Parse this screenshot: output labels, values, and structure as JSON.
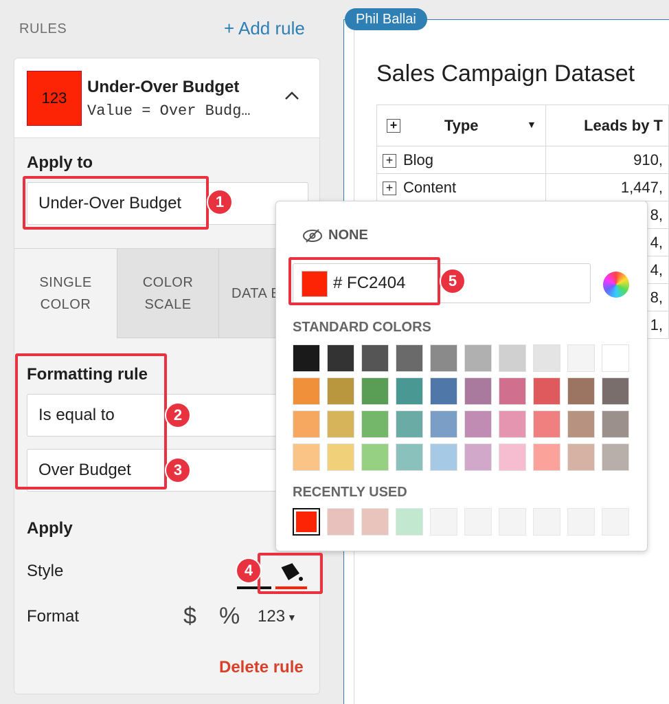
{
  "left_panel": {
    "header": {
      "rules_label": "RULES",
      "add_rule_label": "+ Add rule"
    },
    "rule_card": {
      "preview_text": "123",
      "preview_color": "#FC2404",
      "title": "Under-Over Budget",
      "subtitle": "Value = Over Budg…"
    },
    "apply_to": {
      "heading": "Apply to",
      "value": "Under-Over Budget"
    },
    "tabs": [
      {
        "line1": "SINGLE",
        "line2": "COLOR"
      },
      {
        "line1": "COLOR",
        "line2": "SCALE"
      },
      {
        "line1": "DATA B",
        "line2": ""
      }
    ],
    "formatting_rule": {
      "heading": "Formatting rule",
      "condition": "Is equal to",
      "value": "Over Budget"
    },
    "apply": {
      "heading": "Apply",
      "style_label": "Style",
      "format_label": "Format",
      "format_currency": "$",
      "format_percent": "%",
      "format_number": "123"
    },
    "delete_label": "Delete rule"
  },
  "right_panel": {
    "user_tag": "Phil Ballai",
    "dataset_title": "Sales Campaign Dataset",
    "table": {
      "headers": [
        "Type",
        "Leads by T"
      ],
      "rows": [
        {
          "type": "Blog",
          "leads": "910,"
        },
        {
          "type": "Content",
          "leads": "1,447,"
        },
        {
          "type": "",
          "leads": "8,"
        },
        {
          "type": "",
          "leads": "4,"
        },
        {
          "type": "",
          "leads": "4,"
        },
        {
          "type": "",
          "leads": "8,"
        },
        {
          "type": "",
          "leads": "1,"
        }
      ]
    }
  },
  "color_picker": {
    "none_label": "NONE",
    "hex_prefix": "#",
    "hex_value": "FC2404",
    "current_color": "#FC2404",
    "standard_label": "STANDARD COLORS",
    "standard_colors": [
      [
        "#1a1a1a",
        "#333333",
        "#555555",
        "#6a6a6a",
        "#8a8a8a",
        "#b0b0b0",
        "#d0d0d0",
        "#e4e4e4",
        "#f4f4f4",
        "#ffffff"
      ],
      [
        "#f0903a",
        "#b9973f",
        "#5a9e55",
        "#4a9894",
        "#4f77a8",
        "#a97a9e",
        "#d0708e",
        "#df5a5c",
        "#9c7462",
        "#7a6e6c"
      ],
      [
        "#f6a860",
        "#d6b45a",
        "#74b66a",
        "#6aaba6",
        "#7a9ec6",
        "#c08cb4",
        "#e695b0",
        "#f08080",
        "#b89280",
        "#9c908c"
      ],
      [
        "#fbc487",
        "#f0d078",
        "#95d083",
        "#8bc1bc",
        "#a6cae6",
        "#d2a8ca",
        "#f6bdd0",
        "#fba29a",
        "#d6b2a4",
        "#b8aeaa"
      ]
    ],
    "recent_label": "RECENTLY USED",
    "recent_colors": [
      "#fc2404",
      "#e8c0bc",
      "#e8c4bc",
      "#c2e8d0",
      "#f4f4f4",
      "#f4f4f4",
      "#f4f4f4",
      "#f4f4f4",
      "#f4f4f4",
      "#f4f4f4"
    ]
  },
  "annotations": [
    "1",
    "2",
    "3",
    "4",
    "5"
  ]
}
